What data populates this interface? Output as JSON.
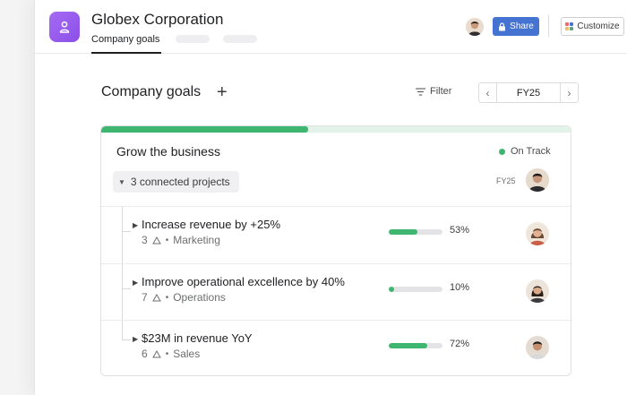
{
  "header": {
    "org_name": "Globex Corporation",
    "active_tab": "Company goals",
    "share_label": "Share",
    "customize_label": "Customize"
  },
  "section": {
    "title": "Company goals",
    "filter_label": "Filter",
    "period": "FY25"
  },
  "goal": {
    "title": "Grow the business",
    "status": "On Track",
    "progress": 0.44,
    "connected_label": "3 connected projects",
    "period": "FY25",
    "sub_goals": [
      {
        "title": "Increase revenue by +25%",
        "count": "3",
        "team": "Marketing",
        "percent_label": "53%",
        "percent": 53
      },
      {
        "title": "Improve operational excellence by 40%",
        "count": "7",
        "team": "Operations",
        "percent_label": "10%",
        "percent": 10
      },
      {
        "title": "$23M in revenue YoY",
        "count": "6",
        "team": "Sales",
        "percent_label": "72%",
        "percent": 72
      }
    ]
  },
  "colors": {
    "accent_blue": "#4573d2",
    "org_purple": "#9b5de5",
    "on_track_green": "#3fb66f"
  },
  "icons": [
    "org-logo-icon",
    "lock-icon",
    "customize-icon",
    "plus-icon",
    "filter-icon",
    "chevron-left-icon",
    "chevron-right-icon",
    "caret-down-icon",
    "caret-right-icon",
    "goal-triangle-icon"
  ]
}
